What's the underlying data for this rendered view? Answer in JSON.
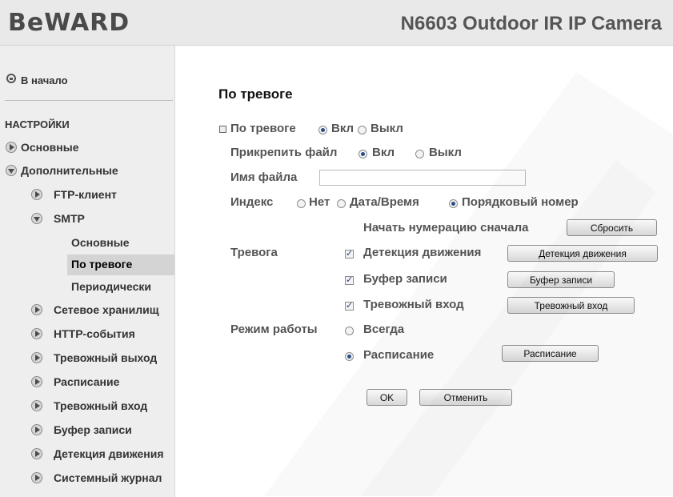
{
  "header": {
    "logo": "BeWARD",
    "camera_title": "N6603 Outdoor IR IP Camera"
  },
  "sidebar": {
    "home": "В начало",
    "section": "НАСТРОЙКИ",
    "items": [
      "Основные",
      "Дополнительные",
      "FTP-клиент",
      "SMTP",
      "Основные",
      "По тревоге",
      "Периодически",
      "Сетевое хранилищ",
      "HTTP-события",
      "Тревожный выход",
      "Расписание",
      "Тревожный вход",
      "Буфер записи",
      "Детекция движения",
      "Системный журнал"
    ]
  },
  "main": {
    "title": "По тревоге",
    "alarm_label": "По тревоге",
    "on": "Вкл",
    "off": "Выкл",
    "attach_label": "Прикрепить файл",
    "filename_label": "Имя файла",
    "filename_value": "",
    "index_label": "Индекс",
    "index_none": "Нет",
    "index_datetime": "Дата/Время",
    "index_serial": "Порядковый номер",
    "restart_numbering": "Начать нумерацию сначала",
    "reset_button": "Сбросить",
    "trigger_label": "Тревога",
    "motion_detection": "Детекция движения",
    "motion_button": "Детекция движения",
    "record_buffer": "Буфер записи",
    "buffer_button": "Буфер записи",
    "alarm_input": "Тревожный вход",
    "alarm_input_button": "Тревожный вход",
    "mode_label": "Режим работы",
    "mode_always": "Всегда",
    "mode_schedule": "Расписание",
    "schedule_button": "Расписание",
    "ok_button": "OK",
    "cancel_button": "Отменить"
  },
  "colors": {
    "header_bg": "#e9e9e9",
    "sidebar_bg": "#eeeeee",
    "active_item": "#d4d4d4"
  }
}
